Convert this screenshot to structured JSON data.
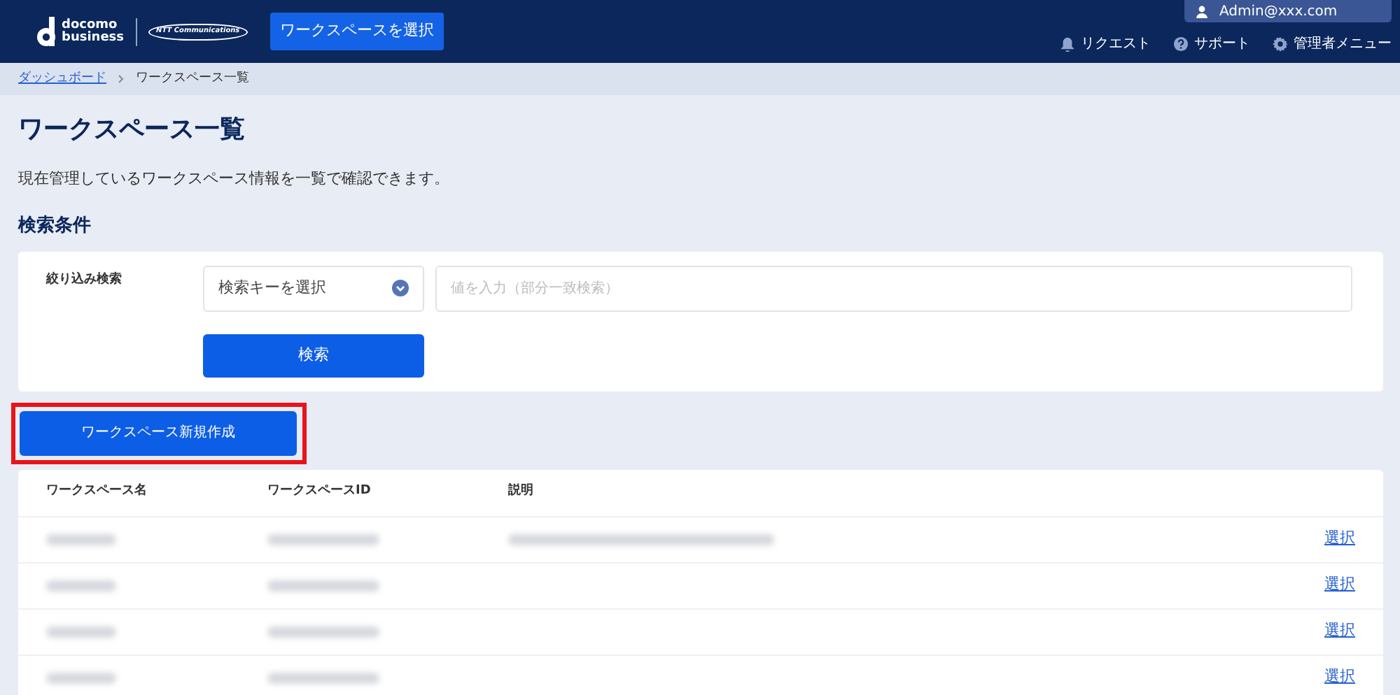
{
  "header": {
    "logo_text_top": "docomo",
    "logo_text_bottom": "business",
    "partner_logo": "NTT Communications",
    "workspace_button": "ワークスペースを選択",
    "account": "Admin@xxx.com",
    "nav": [
      {
        "label": "リクエスト",
        "kind": "bell"
      },
      {
        "label": "サポート",
        "kind": "help"
      },
      {
        "label": "管理者メニュー",
        "kind": "gear"
      }
    ]
  },
  "breadcrumb": [
    {
      "label": "ダッシュボード",
      "link": true
    },
    {
      "label": "ワークスペース一覧",
      "link": false
    }
  ],
  "page_title": "ワークスペース一覧",
  "description": "現在管理しているワークスペース情報を一覧で確認できます。",
  "search": {
    "heading": "検索条件",
    "label": "絞り込み検索",
    "select": "検索キーを選択",
    "placeholder": "値を入力（部分一致検索）",
    "button": "検索"
  },
  "create_button": {
    "label": "ワークスペース新規作成",
    "highlighted": true
  },
  "table": {
    "columns": [
      "ワークスペース名",
      "ワークスペースID",
      "説明"
    ],
    "rows": [
      {
        "has_description": true,
        "action": "選択"
      },
      {
        "has_description": false,
        "action": "選択"
      },
      {
        "has_description": false,
        "action": "選択"
      },
      {
        "has_description": false,
        "action": "選択"
      }
    ]
  }
}
